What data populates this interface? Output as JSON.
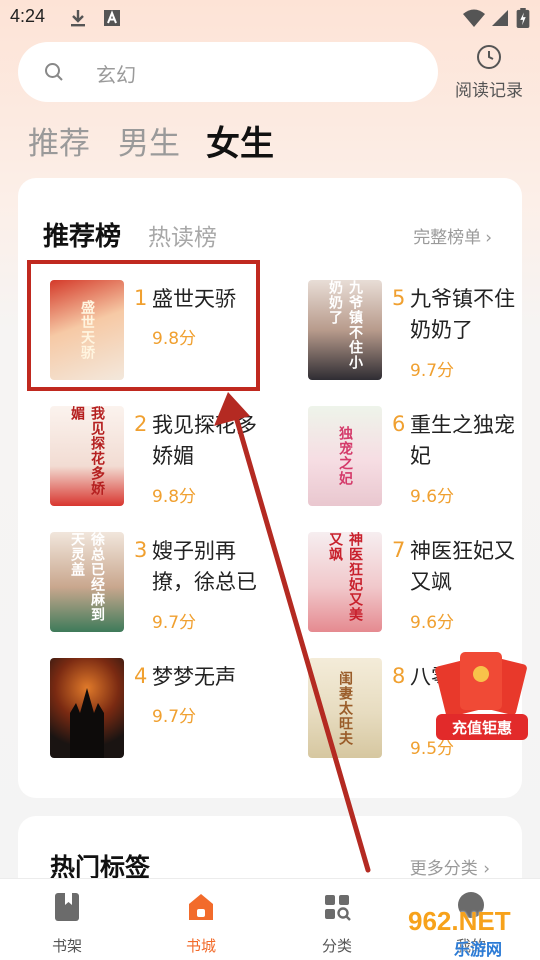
{
  "status_bar": {
    "time": "4:24"
  },
  "search": {
    "placeholder": "玄幻"
  },
  "history": {
    "label": "阅读记录"
  },
  "tabs": [
    {
      "label": "推荐",
      "active": false
    },
    {
      "label": "男生",
      "active": false
    },
    {
      "label": "女生",
      "active": true
    }
  ],
  "ranking": {
    "tabs": [
      {
        "label": "推荐榜",
        "active": true
      },
      {
        "label": "热读榜",
        "active": false
      }
    ],
    "full_list_label": "完整榜单",
    "books": [
      {
        "rank": "1",
        "title": "盛世天骄",
        "score": "9.8分",
        "cover_text": "盛世天骄"
      },
      {
        "rank": "2",
        "title": "我见探花多娇媚",
        "score": "9.8分",
        "cover_text": "我见探花多娇媚"
      },
      {
        "rank": "3",
        "title": "嫂子别再撩，徐总已经麻…",
        "score": "9.7分",
        "cover_text": "徐总已经麻到天灵盖"
      },
      {
        "rank": "4",
        "title": "梦梦无声",
        "score": "9.7分",
        "cover_text": ""
      },
      {
        "rank": "5",
        "title": "九爷镇不住奶奶了",
        "score": "9.7分",
        "cover_text": "九爷镇不住小奶奶了"
      },
      {
        "rank": "6",
        "title": "重生之独宠妃",
        "score": "9.6分",
        "cover_text": "独宠之妃"
      },
      {
        "rank": "7",
        "title": "神医狂妃又又飒",
        "score": "9.6分",
        "cover_text": "神医狂妃又美又飒"
      },
      {
        "rank": "8",
        "title": "八零妻太",
        "score": "9.5分",
        "cover_text": "闺妻太旺夫"
      }
    ]
  },
  "hot_tags": {
    "title": "热门标签",
    "more_label": "更多分类"
  },
  "promo": {
    "label": "充值钜惠"
  },
  "watermark": {
    "text": "962.NET",
    "subtext": "乐游网"
  },
  "bottom_nav": [
    {
      "label": "书架",
      "icon": "bookshelf-icon",
      "active": false
    },
    {
      "label": "书城",
      "icon": "bookstore-icon",
      "active": true
    },
    {
      "label": "分类",
      "icon": "category-icon",
      "active": false
    },
    {
      "label": "我的",
      "icon": "profile-icon",
      "active": false
    }
  ],
  "colors": {
    "accent": "#f26b2b",
    "score": "#f0a030",
    "highlight": "#c0291f"
  }
}
